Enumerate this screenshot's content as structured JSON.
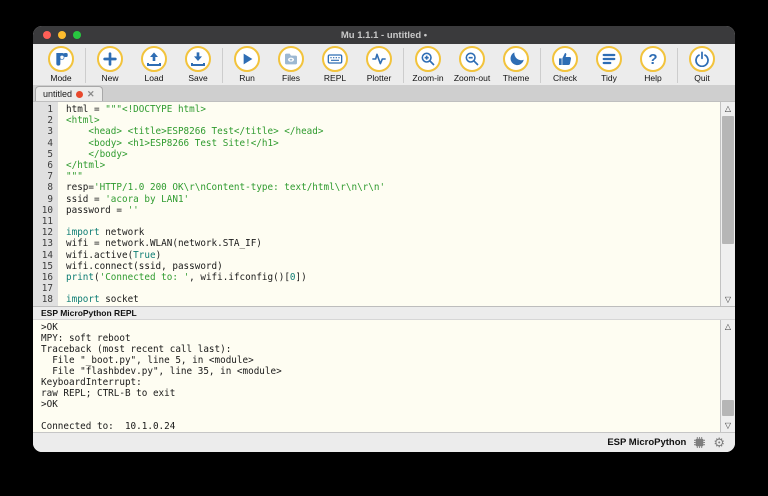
{
  "window": {
    "title": "Mu 1.1.1 - untitled •"
  },
  "colors": {
    "titlebar": "#3a3a3c",
    "traffic_red": "#ff5f57",
    "traffic_yellow": "#febc2e",
    "traffic_green": "#28c840",
    "icon_ring": "#f2c33c",
    "icon_blue": "#2e6db4",
    "editor_bg": "#fefdf2",
    "string_green": "#2f9b2f",
    "keyword_teal": "#0e7d74",
    "tab_dot_red": "#e8482c"
  },
  "toolbar": {
    "buttons": [
      {
        "label": "Mode"
      },
      {
        "label": "New"
      },
      {
        "label": "Load"
      },
      {
        "label": "Save"
      },
      {
        "label": "Run"
      },
      {
        "label": "Files"
      },
      {
        "label": "REPL"
      },
      {
        "label": "Plotter"
      },
      {
        "label": "Zoom-in"
      },
      {
        "label": "Zoom-out"
      },
      {
        "label": "Theme"
      },
      {
        "label": "Check"
      },
      {
        "label": "Tidy"
      },
      {
        "label": "Help"
      },
      {
        "label": "Quit"
      }
    ]
  },
  "tab": {
    "label": "untitled",
    "close": "✕"
  },
  "editor": {
    "lines": [
      {
        "n": 1,
        "segs": [
          {
            "t": "html = ",
            "k": "d"
          },
          {
            "t": "\"\"\"<!DOCTYPE html>",
            "k": "s"
          }
        ]
      },
      {
        "n": 2,
        "segs": [
          {
            "t": "<html>",
            "k": "s"
          }
        ]
      },
      {
        "n": 3,
        "segs": [
          {
            "t": "    <head> <title>ESP8266 Test</title> </head>",
            "k": "s"
          }
        ]
      },
      {
        "n": 4,
        "segs": [
          {
            "t": "    <body> <h1>ESP8266 Test Site!</h1>",
            "k": "s"
          }
        ]
      },
      {
        "n": 5,
        "segs": [
          {
            "t": "    </body>",
            "k": "s"
          }
        ]
      },
      {
        "n": 6,
        "segs": [
          {
            "t": "</html>",
            "k": "s"
          }
        ]
      },
      {
        "n": 7,
        "segs": [
          {
            "t": "\"\"\"",
            "k": "s"
          }
        ]
      },
      {
        "n": 8,
        "segs": [
          {
            "t": "resp=",
            "k": "d"
          },
          {
            "t": "'HTTP/1.0 200 OK\\r\\nContent-type: text/html\\r\\n\\r\\n'",
            "k": "s"
          }
        ]
      },
      {
        "n": 9,
        "segs": [
          {
            "t": "ssid = ",
            "k": "d"
          },
          {
            "t": "'acora by LAN1'",
            "k": "s"
          }
        ]
      },
      {
        "n": 10,
        "segs": [
          {
            "t": "password = ",
            "k": "d"
          },
          {
            "t": "''",
            "k": "s"
          }
        ]
      },
      {
        "n": 11,
        "segs": []
      },
      {
        "n": 12,
        "segs": [
          {
            "t": "import",
            "k": "kw"
          },
          {
            "t": " network",
            "k": "d"
          }
        ]
      },
      {
        "n": 13,
        "segs": [
          {
            "t": "wifi = network.WLAN(network.STA_IF)",
            "k": "d"
          }
        ]
      },
      {
        "n": 14,
        "segs": [
          {
            "t": "wifi.active(",
            "k": "d"
          },
          {
            "t": "True",
            "k": "kw"
          },
          {
            "t": ")",
            "k": "d"
          }
        ]
      },
      {
        "n": 15,
        "segs": [
          {
            "t": "wifi.connect(ssid, password)",
            "k": "d"
          }
        ]
      },
      {
        "n": 16,
        "segs": [
          {
            "t": "print",
            "k": "kw"
          },
          {
            "t": "(",
            "k": "d"
          },
          {
            "t": "'Connected to: '",
            "k": "s"
          },
          {
            "t": ", wifi.ifconfig()[",
            "k": "d"
          },
          {
            "t": "0",
            "k": "num"
          },
          {
            "t": "])",
            "k": "d"
          }
        ]
      },
      {
        "n": 17,
        "segs": []
      },
      {
        "n": 18,
        "segs": [
          {
            "t": "import",
            "k": "kw"
          },
          {
            "t": " socket",
            "k": "d"
          }
        ]
      }
    ]
  },
  "repl": {
    "header": "ESP MicroPython REPL",
    "lines": [
      ">OK",
      "MPY: soft reboot",
      "Traceback (most recent call last):",
      "  File \"_boot.py\", line 5, in <module>",
      "  File \"flashbdev.py\", line 35, in <module>",
      "KeyboardInterrupt:",
      "raw REPL; CTRL-B to exit",
      ">OK",
      "",
      "Connected to:  10.1.0.24"
    ]
  },
  "statusbar": {
    "mode": "ESP MicroPython"
  }
}
